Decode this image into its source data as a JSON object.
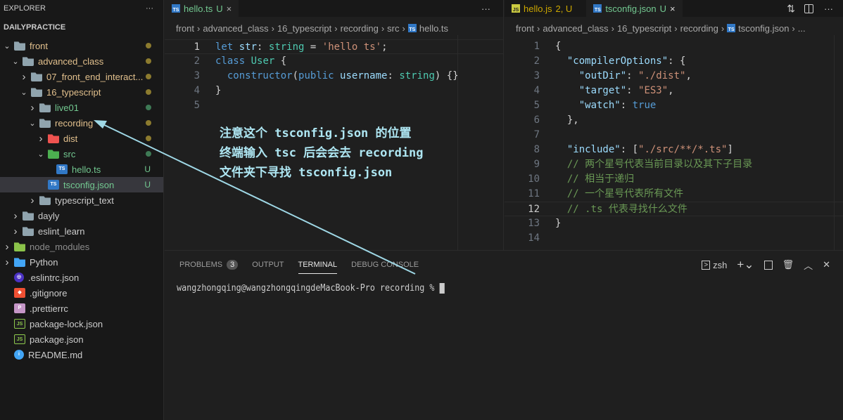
{
  "sidebar": {
    "title": "EXPLORER",
    "more": "···",
    "workspace": "DAILYPRACTICE",
    "items": [
      {
        "label": "front",
        "depth": 0,
        "chev": "v",
        "icon": "folder-open",
        "color": "#e2c08d",
        "dot": "#8c7b2e"
      },
      {
        "label": "advanced_class",
        "depth": 1,
        "chev": "v",
        "icon": "folder-open",
        "color": "#e2c08d",
        "dot": "#8c7b2e"
      },
      {
        "label": "07_front_end_interact...",
        "depth": 2,
        "chev": ">",
        "icon": "folder",
        "color": "#e2c08d",
        "dot": "#8c7b2e"
      },
      {
        "label": "16_typescript",
        "depth": 2,
        "chev": "v",
        "icon": "folder-open",
        "color": "#e2c08d",
        "dot": "#8c7b2e"
      },
      {
        "label": "live01",
        "depth": 3,
        "chev": ">",
        "icon": "folder",
        "color": "#73c991",
        "dot": "#3e7a55"
      },
      {
        "label": "recording",
        "depth": 3,
        "chev": "v",
        "icon": "folder-open",
        "color": "#e2c08d",
        "dot": "#8c7b2e"
      },
      {
        "label": "dist",
        "depth": 4,
        "chev": ">",
        "icon": "folder-dist",
        "color": "#e2c08d",
        "dot": "#8c7b2e"
      },
      {
        "label": "src",
        "depth": 4,
        "chev": "v",
        "icon": "folder-src",
        "color": "#73c991",
        "dot": "#3e7a55"
      },
      {
        "label": "hello.ts",
        "depth": 5,
        "chev": "",
        "icon": "ts",
        "color": "#73c991",
        "badge": "U"
      },
      {
        "label": "tsconfig.json",
        "depth": 4,
        "chev": "",
        "icon": "tsconfig",
        "color": "#73c991",
        "badge": "U",
        "selected": true
      },
      {
        "label": "typescript_text",
        "depth": 3,
        "chev": ">",
        "icon": "folder",
        "color": "#cccccc"
      },
      {
        "label": "dayly",
        "depth": 1,
        "chev": ">",
        "icon": "folder",
        "color": "#cccccc"
      },
      {
        "label": "eslint_learn",
        "depth": 1,
        "chev": ">",
        "icon": "folder",
        "color": "#cccccc"
      },
      {
        "label": "node_modules",
        "depth": 0,
        "chev": ">",
        "icon": "folder-node",
        "color": "#8c8c8c"
      },
      {
        "label": "Python",
        "depth": 0,
        "chev": ">",
        "icon": "folder-python",
        "color": "#cccccc"
      },
      {
        "label": ".eslintrc.json",
        "depth": 0,
        "chev": "",
        "icon": "eslint",
        "color": "#cccccc"
      },
      {
        "label": ".gitignore",
        "depth": 0,
        "chev": "",
        "icon": "git",
        "color": "#cccccc"
      },
      {
        "label": ".prettierrc",
        "depth": 0,
        "chev": "",
        "icon": "prettier",
        "color": "#cccccc"
      },
      {
        "label": "package-lock.json",
        "depth": 0,
        "chev": "",
        "icon": "nodejs",
        "color": "#cccccc"
      },
      {
        "label": "package.json",
        "depth": 0,
        "chev": "",
        "icon": "nodejs",
        "color": "#cccccc"
      },
      {
        "label": "README.md",
        "depth": 0,
        "chev": "",
        "icon": "info",
        "color": "#cccccc"
      }
    ]
  },
  "left_editor": {
    "tab": {
      "label": "hello.ts",
      "status": "U",
      "close": "×"
    },
    "more": "···",
    "breadcrumb": [
      "front",
      "advanced_class",
      "16_typescript",
      "recording",
      "src",
      "hello.ts"
    ],
    "current_line": 1,
    "lines": [
      [
        [
          "kw",
          "let"
        ],
        [
          "pn",
          " "
        ],
        [
          "var",
          "str"
        ],
        [
          "pn",
          ": "
        ],
        [
          "ty",
          "string"
        ],
        [
          "pn",
          " = "
        ],
        [
          "str",
          "'hello ts'"
        ],
        [
          "pn",
          ";"
        ]
      ],
      [
        [
          "kw",
          "class"
        ],
        [
          "pn",
          " "
        ],
        [
          "ty",
          "User"
        ],
        [
          "pn",
          " {"
        ]
      ],
      [
        [
          "pn",
          "  "
        ],
        [
          "kw",
          "constructor"
        ],
        [
          "pn",
          "("
        ],
        [
          "kw",
          "public"
        ],
        [
          "pn",
          " "
        ],
        [
          "var",
          "username"
        ],
        [
          "pn",
          ": "
        ],
        [
          "ty",
          "string"
        ],
        [
          "pn",
          ") {}"
        ]
      ],
      [
        [
          "pn",
          "}"
        ]
      ],
      []
    ]
  },
  "right_editor": {
    "tabs": [
      {
        "label": "hello.js",
        "status": "2, U"
      },
      {
        "label": "tsconfig.json",
        "status": "U",
        "close": "×"
      }
    ],
    "more": "···",
    "breadcrumb": [
      "front",
      "advanced_class",
      "16_typescript",
      "recording",
      "tsconfig.json",
      "..."
    ],
    "current_line": 12,
    "lines": [
      [
        [
          "pn",
          "{"
        ]
      ],
      [
        [
          "pn",
          "  "
        ],
        [
          "key",
          "\"compilerOptions\""
        ],
        [
          "pn",
          ": {"
        ]
      ],
      [
        [
          "pn",
          "    "
        ],
        [
          "key",
          "\"outDir\""
        ],
        [
          "pn",
          ": "
        ],
        [
          "str",
          "\"./dist\""
        ],
        [
          "pn",
          ","
        ]
      ],
      [
        [
          "pn",
          "    "
        ],
        [
          "key",
          "\"target\""
        ],
        [
          "pn",
          ": "
        ],
        [
          "str",
          "\"ES3\""
        ],
        [
          "pn",
          ","
        ]
      ],
      [
        [
          "pn",
          "    "
        ],
        [
          "key",
          "\"watch\""
        ],
        [
          "pn",
          ": "
        ],
        [
          "kw",
          "true"
        ]
      ],
      [
        [
          "pn",
          "  },"
        ]
      ],
      [],
      [
        [
          "pn",
          "  "
        ],
        [
          "key",
          "\"include\""
        ],
        [
          "pn",
          ": ["
        ],
        [
          "str",
          "\"./src/**/*.ts\""
        ],
        [
          "pn",
          "]"
        ]
      ],
      [
        [
          "pn",
          "  "
        ],
        [
          "cm",
          "// 两个星号代表当前目录以及其下子目录"
        ]
      ],
      [
        [
          "pn",
          "  "
        ],
        [
          "cm",
          "// 相当于递归"
        ]
      ],
      [
        [
          "pn",
          "  "
        ],
        [
          "cm",
          "// 一个星号代表所有文件"
        ]
      ],
      [
        [
          "pn",
          "  "
        ],
        [
          "cm",
          "// .ts 代表寻找什么文件"
        ]
      ],
      [
        [
          "pn",
          "}"
        ]
      ],
      []
    ]
  },
  "panel": {
    "tabs": [
      {
        "label": "PROBLEMS",
        "badge": "3"
      },
      {
        "label": "OUTPUT"
      },
      {
        "label": "TERMINAL",
        "active": true
      },
      {
        "label": "DEBUG CONSOLE"
      }
    ],
    "shell": "zsh",
    "terminal_line": "wangzhongqing@wangzhongqingdeMacBook-Pro recording % "
  },
  "annotation": {
    "lines": [
      "注意这个 tsconfig.json 的位置",
      "终端输入 tsc 后会会去 recording",
      "文件夹下寻找 tsconfig.json"
    ],
    "color": "#aee6f2"
  }
}
